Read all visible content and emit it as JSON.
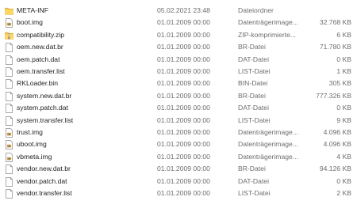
{
  "files": [
    {
      "name": "META-INF",
      "date": "05.02.2021 23:48",
      "type": "Dateiordner",
      "size": "",
      "icon": "folder-icon"
    },
    {
      "name": "boot.img",
      "date": "01.01.2009 00:00",
      "type": "Datenträgerimage...",
      "size": "32.768 KB",
      "icon": "disk-image-icon"
    },
    {
      "name": "compatibility.zip",
      "date": "01.01.2009 00:00",
      "type": "ZIP-komprimierte...",
      "size": "6 KB",
      "icon": "zip-folder-icon"
    },
    {
      "name": "oem.new.dat.br",
      "date": "01.01.2009 00:00",
      "type": "BR-Datei",
      "size": "71.780 KB",
      "icon": "file-icon"
    },
    {
      "name": "oem.patch.dat",
      "date": "01.01.2009 00:00",
      "type": "DAT-Datei",
      "size": "0 KB",
      "icon": "file-icon"
    },
    {
      "name": "oem.transfer.list",
      "date": "01.01.2009 00:00",
      "type": "LIST-Datei",
      "size": "1 KB",
      "icon": "file-icon"
    },
    {
      "name": "RKLoader.bin",
      "date": "01.01.2009 00:00",
      "type": "BIN-Datei",
      "size": "305 KB",
      "icon": "file-icon"
    },
    {
      "name": "system.new.dat.br",
      "date": "01.01.2009 00:00",
      "type": "BR-Datei",
      "size": "777.326 KB",
      "icon": "file-icon"
    },
    {
      "name": "system.patch.dat",
      "date": "01.01.2009 00:00",
      "type": "DAT-Datei",
      "size": "0 KB",
      "icon": "file-icon"
    },
    {
      "name": "system.transfer.list",
      "date": "01.01.2009 00:00",
      "type": "LIST-Datei",
      "size": "9 KB",
      "icon": "file-icon"
    },
    {
      "name": "trust.img",
      "date": "01.01.2009 00:00",
      "type": "Datenträgerimage...",
      "size": "4.096 KB",
      "icon": "disk-image-icon"
    },
    {
      "name": "uboot.img",
      "date": "01.01.2009 00:00",
      "type": "Datenträgerimage...",
      "size": "4.096 KB",
      "icon": "disk-image-icon"
    },
    {
      "name": "vbmeta.img",
      "date": "01.01.2009 00:00",
      "type": "Datenträgerimage...",
      "size": "4 KB",
      "icon": "disk-image-icon"
    },
    {
      "name": "vendor.new.dat.br",
      "date": "01.01.2009 00:00",
      "type": "BR-Datei",
      "size": "94.126 KB",
      "icon": "file-icon"
    },
    {
      "name": "vendor.patch.dat",
      "date": "01.01.2009 00:00",
      "type": "DAT-Datei",
      "size": "0 KB",
      "icon": "file-icon"
    },
    {
      "name": "vendor.transfer.list",
      "date": "01.01.2009 00:00",
      "type": "LIST-Datei",
      "size": "2 KB",
      "icon": "file-icon"
    }
  ]
}
